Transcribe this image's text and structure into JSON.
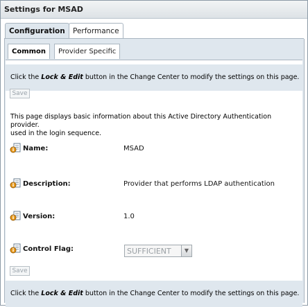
{
  "window": {
    "title": "Settings for MSAD"
  },
  "tabs": [
    {
      "label": "Configuration",
      "active": true
    },
    {
      "label": "Performance",
      "active": false
    }
  ],
  "subtabs": [
    {
      "label": "Common",
      "active": true
    },
    {
      "label": "Provider Specific",
      "active": false
    }
  ],
  "notice": {
    "prefix": "Click the ",
    "emphasis": "Lock & Edit",
    "suffix": " button in the Change Center to modify the settings on this page."
  },
  "save_label": "Save",
  "description_line1": "This page displays basic information about this Active Directory Authentication provider.",
  "description_line2": "used in the login sequence.",
  "fields": {
    "name": {
      "label": "Name:",
      "value": "MSAD",
      "icon": "info-icon"
    },
    "description": {
      "label": "Description:",
      "value": "Provider that performs LDAP authentication",
      "icon": "info-icon"
    },
    "version": {
      "label": "Version:",
      "value": "1.0",
      "icon": "info-icon"
    },
    "control_flag": {
      "label": "Control Flag:",
      "value": "SUFFICIENT",
      "icon": "info-icon"
    }
  },
  "colors": {
    "panel": "#dfe7ee",
    "border": "#a9b5c0",
    "disabled_text": "#9aa3aa"
  }
}
